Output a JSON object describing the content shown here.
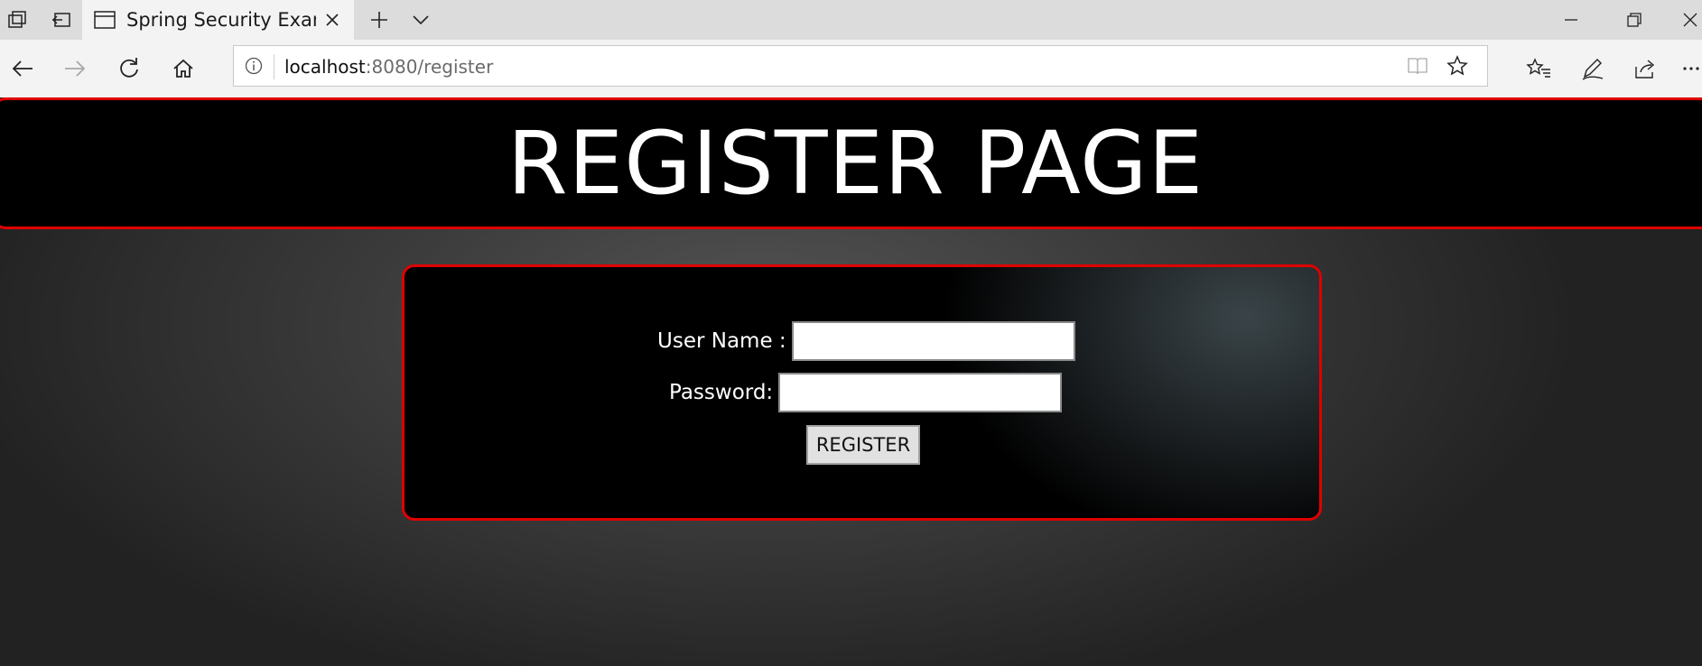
{
  "browser": {
    "tab_title": "Spring Security Example",
    "url_host": "localhost",
    "url_path": ":8080/register"
  },
  "page": {
    "header_title": "REGISTER PAGE",
    "username_label": "User Name :",
    "username_value": "",
    "password_label": "Password:",
    "password_value": "",
    "register_button": "REGISTER"
  },
  "colors": {
    "accent_border": "#e00000",
    "header_bg": "#000000",
    "text": "#ffffff"
  }
}
